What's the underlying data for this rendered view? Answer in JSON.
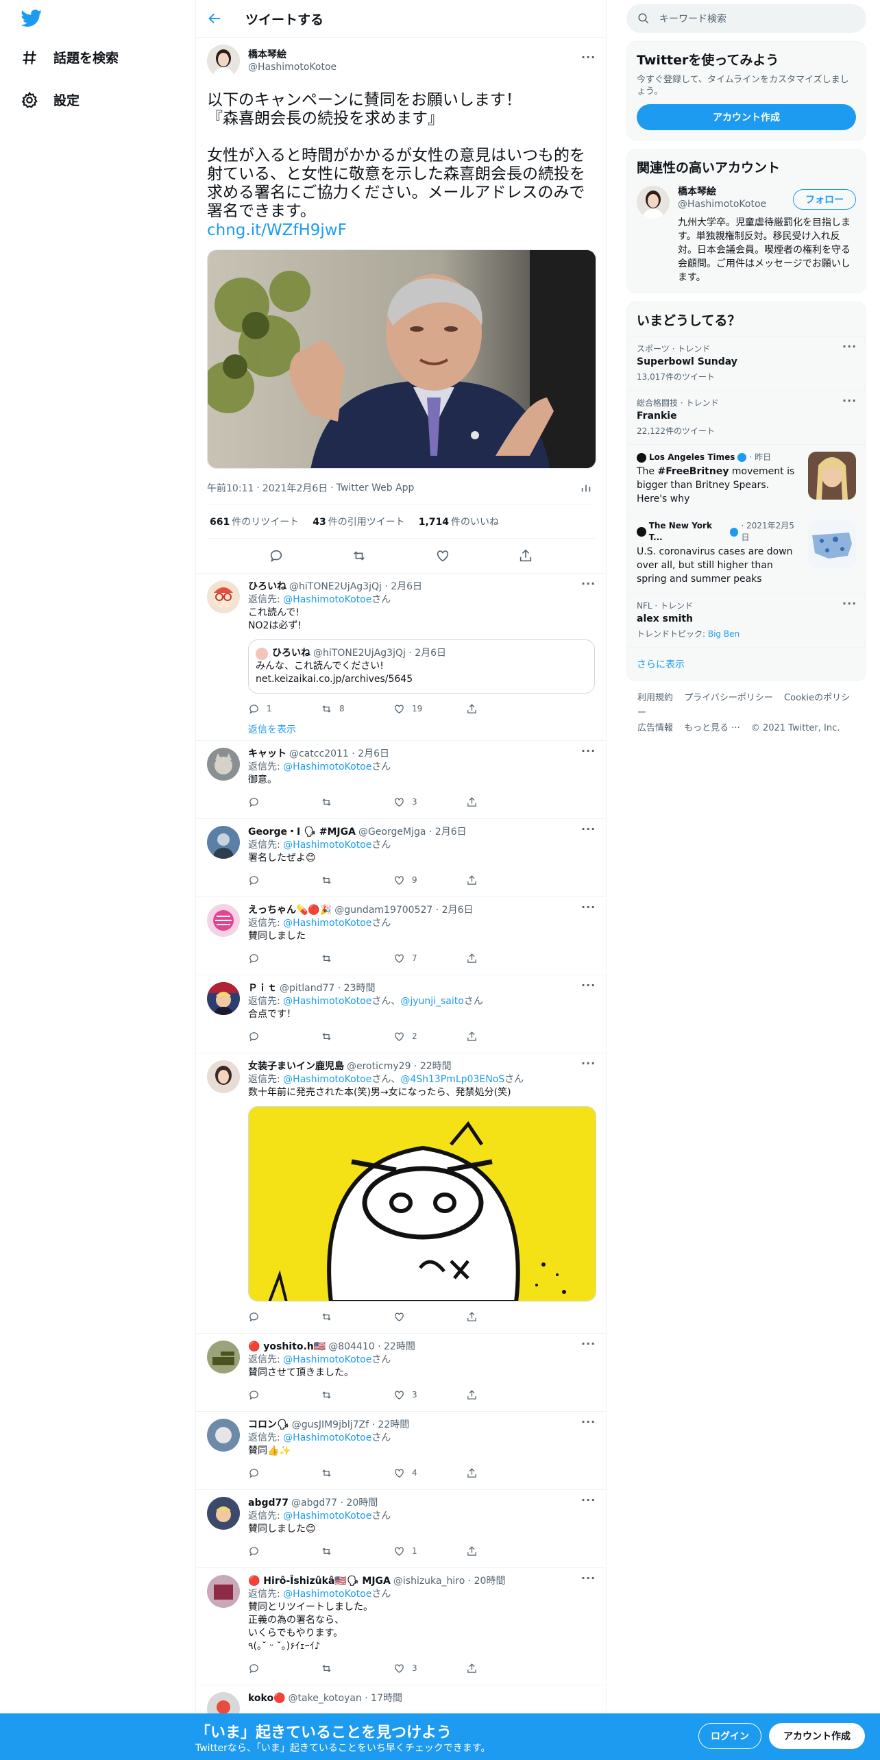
{
  "nav": {
    "explore_label": "話題を検索",
    "settings_label": "設定",
    "header_title": "ツイートする"
  },
  "tweet": {
    "name": "橋本琴絵",
    "handle": "@HashimotoKotoe",
    "text": "以下のキャンペーンに賛同をお願いします！\n『森喜朗会長の続投を求めます』\n\n女性が入ると時間がかかるが女性の意見はいつも的を射ている、と女性に敬意を示した森喜朗会長の続投を求める署名にご協力ください。メールアドレスのみで署名できます。",
    "link": "chng.it/WZfH9jwF",
    "time": "午前10:11",
    "date": "2021年2月6日",
    "client": "Twitter Web App",
    "retweets": "661",
    "retweets_label": "件のリツイート",
    "quotes": "43",
    "quotes_label": "件の引用ツイート",
    "likes": "1,714",
    "likes_label": "件のいいね"
  },
  "replies": [
    {
      "name": "ひろいね",
      "handle": "@hiTONE2UjAg3jQj",
      "time": "2月6日",
      "to_prefix": "返信先: ",
      "to": "@HashimotoKotoe",
      "to_suffix": "さん",
      "text": "これ読んで!\nNO2は必ず!",
      "reply": "1",
      "rt": "8",
      "like": "19",
      "quote": {
        "name": "ひろいね",
        "handle": "@hiTONE2UjAg3jQj",
        "time": "2月6日",
        "text": "みんな、これ読んでください!\nnet.keizaikai.co.jp/archives/5645"
      },
      "show_replies": "返信を表示"
    },
    {
      "name": "キャット",
      "handle": "@catcc2011",
      "time": "2月6日",
      "to_prefix": "返信先: ",
      "to": "@HashimotoKotoe",
      "to_suffix": "さん",
      "text": "御意。",
      "reply": "",
      "rt": "",
      "like": "3"
    },
    {
      "name": "George・I 🗣 #MJGA",
      "handle": "@GeorgeMjga",
      "time": "2月6日",
      "to_prefix": "返信先: ",
      "to": "@HashimotoKotoe",
      "to_suffix": "さん",
      "text": "署名したぜよ😊",
      "reply": "",
      "rt": "",
      "like": "9"
    },
    {
      "name": "えっちゃん💊🔴🎉",
      "handle": "@gundam19700527",
      "time": "2月6日",
      "to_prefix": "返信先: ",
      "to": "@HashimotoKotoe",
      "to_suffix": "さん",
      "text": "賛同しました",
      "reply": "",
      "rt": "",
      "like": "7"
    },
    {
      "name": "Ｐｉｔ",
      "handle": "@pitland77",
      "time": "23時間",
      "to_prefix": "返信先: ",
      "to": "@HashimotoKotoe",
      "to_suffix": "さん、",
      "to2": "@jyunji_saito",
      "to2_suffix": "さん",
      "text": "合点です！",
      "reply": "",
      "rt": "",
      "like": "2"
    },
    {
      "name": "女装子まいイン鹿児島",
      "handle": "@eroticmy29",
      "time": "22時間",
      "to_prefix": "返信先: ",
      "to": "@HashimotoKotoe",
      "to_suffix": "さん、",
      "to2": "@4Sh13PmLp03ENoS",
      "to2_suffix": "さん",
      "text": "数十年前に発売された本(笑)男→女になったら、発禁処分(笑)",
      "reply": "",
      "rt": "",
      "like": ""
    },
    {
      "name": "🔴 yoshito.h🇺🇸",
      "handle": "@804410",
      "time": "22時間",
      "to_prefix": "返信先: ",
      "to": "@HashimotoKotoe",
      "to_suffix": "さん",
      "text": "賛同させて頂きました。",
      "reply": "",
      "rt": "",
      "like": "3"
    },
    {
      "name": "コロン🗣",
      "handle": "@gusJIM9jblj7Zf",
      "time": "22時間",
      "to_prefix": "返信先: ",
      "to": "@HashimotoKotoe",
      "to_suffix": "さん",
      "text": "賛同👍✨",
      "reply": "",
      "rt": "",
      "like": "4"
    },
    {
      "name": "abgd77",
      "handle": "@abgd77",
      "time": "20時間",
      "to_prefix": "返信先: ",
      "to": "@HashimotoKotoe",
      "to_suffix": "さん",
      "text": "賛同しました😊",
      "reply": "",
      "rt": "",
      "like": "1"
    },
    {
      "name": "🔴 Hirô-Îshizûkâ🇺🇸🗣 MJGA",
      "handle": "@ishizuka_hiro",
      "time": "20時間",
      "to_prefix": "返信先: ",
      "to": "@HashimotoKotoe",
      "to_suffix": "さん",
      "text": "賛同とリツイートしました。\n正義の為の署名なら、\nいくらでもやります。\n٩(｡˘ ᵕ ˘｡)۶ｲｪｰｲ♪",
      "reply": "",
      "rt": "",
      "like": "3"
    },
    {
      "name": "koko🔴",
      "handle": "@take_kotoyan",
      "time": "17時間",
      "to_prefix": "",
      "to": "",
      "to_suffix": "",
      "text": "",
      "reply": "",
      "rt": "",
      "like": ""
    }
  ],
  "sidebar": {
    "search_placeholder": "キーワード検索",
    "signup_title": "Twitterを使ってみよう",
    "signup_sub": "今すぐ登録して、タイムラインをカスタマイズしましょう。",
    "signup_button": "アカウント作成",
    "related_title": "関連性の高いアカウント",
    "related": {
      "name": "橋本琴絵",
      "handle": "@HashimotoKotoe",
      "follow": "フォロー",
      "bio": "九州大学卒。児童虐待厳罰化を目指します。単独親権制反対。移民受け入れ反対。日本会議会員。喫煙者の権利を守る会顧問。ご用件はメッセージでお願いします。"
    },
    "trends_title": "いまどうしてる？",
    "trends": [
      {
        "cat": "スポーツ · トレンド",
        "title": "Superbowl Sunday",
        "count": "13,017件のツイート"
      },
      {
        "cat": "総合格闘技 · トレンド",
        "title": "Frankie",
        "count": "22,122件のツイート"
      }
    ],
    "news": [
      {
        "source": "Los Angeles Times",
        "time": "· 昨日",
        "text_pre": "The ",
        "text_bold": "#FreeBritney",
        "text_post": " movement is bigger than Britney Spears. Here's why"
      },
      {
        "source": "The New York T...",
        "time": "· 2021年2月5日",
        "text_pre": "U.S. coronavirus cases are down over all, but still higher than spring and summer peaks",
        "text_bold": "",
        "text_post": ""
      }
    ],
    "trend3": {
      "cat": "NFL · トレンド",
      "title": "alex smith",
      "topic_prefix": "トレンドトピック: ",
      "topic": "Big Ben"
    },
    "show_more": "さらに表示",
    "footer": [
      "利用規約",
      "プライバシーポリシー",
      "Cookieのポリシー",
      "広告情報",
      "もっと見る ···",
      "© 2021 Twitter, Inc."
    ]
  },
  "bottom_bar": {
    "title": "「いま」起きていることを見つけよう",
    "subtitle": "Twitterなら、「いま」起きていることをいち早くチェックできます。",
    "login": "ログイン",
    "signup": "アカウント作成"
  },
  "colors": {
    "accent": "#1d9bf0",
    "text": "#0f1419",
    "muted": "#536471"
  }
}
